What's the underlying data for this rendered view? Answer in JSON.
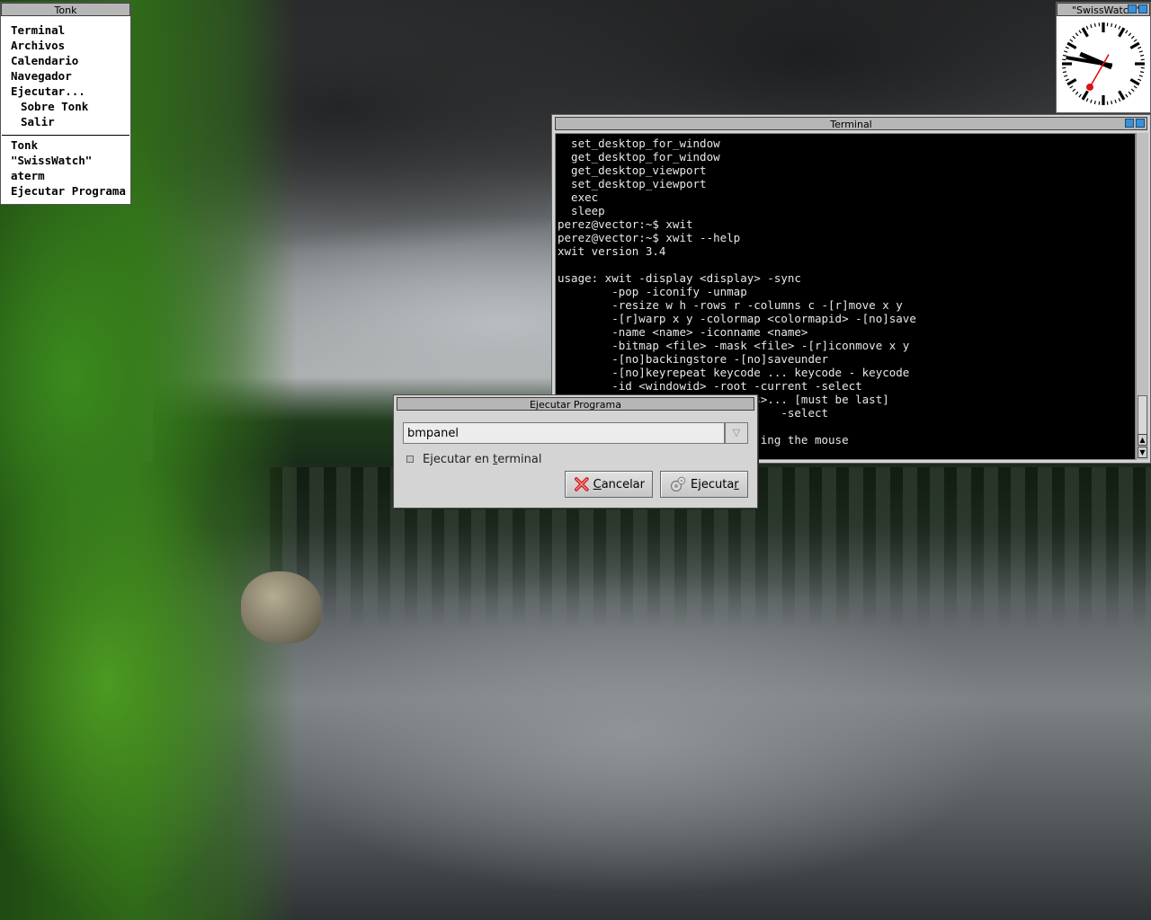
{
  "root_menu": {
    "title": "Tonk",
    "items_top": [
      "Terminal",
      "Archivos",
      "Calendario",
      "Navegador",
      "Ejecutar..."
    ],
    "items_sub": [
      "Sobre Tonk",
      "Salir"
    ],
    "items_windows": [
      "Tonk",
      "\"SwissWatch\"",
      "aterm",
      "Ejecutar Programa"
    ]
  },
  "clock": {
    "title": "\"SwissWatch\"",
    "time": {
      "hour": 9,
      "minute": 46,
      "second": 35
    },
    "second_hand_color": "#e01010"
  },
  "terminal": {
    "title": "Terminal",
    "lines": [
      "  set_desktop_for_window",
      "  get_desktop_for_window",
      "  get_desktop_viewport",
      "  set_desktop_viewport",
      "  exec",
      "  sleep",
      "perez@vector:~$ xwit",
      "perez@vector:~$ xwit --help",
      "xwit version 3.4",
      "",
      "usage: xwit -display <display> -sync",
      "        -pop -iconify -unmap",
      "        -resize w h -rows r -columns c -[r]move x y",
      "        -[r]warp x y -colormap <colormapid> -[no]save",
      "        -name <name> -iconname <name>",
      "        -bitmap <file> -mask <file> -[r]iconmove x y",
      "        -[no]backingstore -[no]saveunder",
      "        -[no]keyrepeat keycode ... keycode - keycode",
      "        -id <windowid> -root -current -select",
      "        -names <initialstrings>... [must be last]",
      "                                 -select",
      "",
      "                              ing the mouse"
    ],
    "scroll_up_icon": "▲",
    "scroll_down_icon": "▼"
  },
  "run_dialog": {
    "title": "Ejecutar Programa",
    "command_value": "bmpanel",
    "dropdown_icon": "▽",
    "checkbox_label_pre": "Ejecutar en ",
    "checkbox_label_mnemonic": "t",
    "checkbox_label_post": "erminal",
    "checkbox_checked": false,
    "cancel_mnemonic": "C",
    "cancel_rest": "ancelar",
    "run_pre": "E",
    "run_mid": "jecuta",
    "run_mnemonic": "r",
    "cancel_icon_color": "#d42020"
  }
}
